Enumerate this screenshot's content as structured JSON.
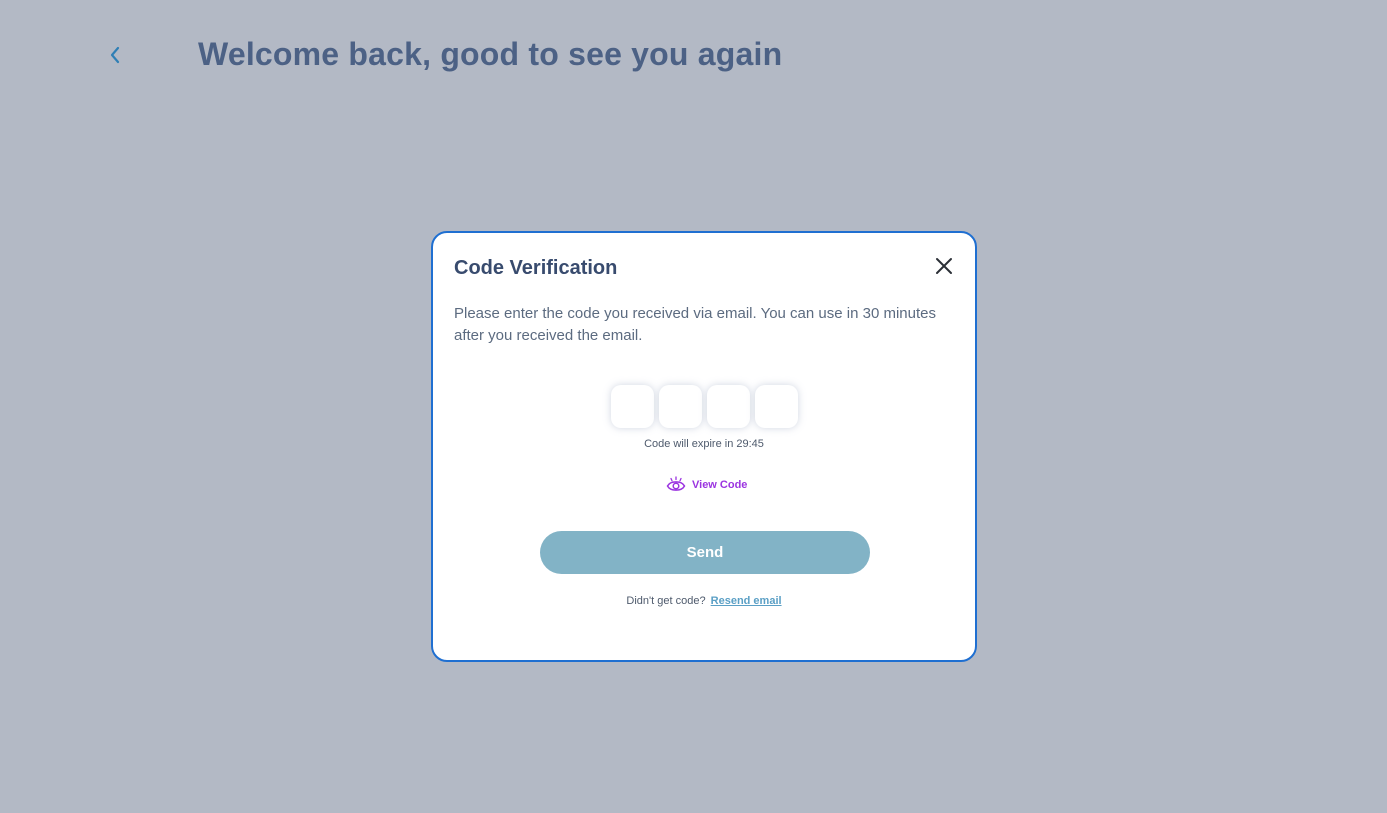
{
  "header": {
    "back_icon": "chevron-left-icon",
    "title": "Welcome back, good to see you again"
  },
  "modal": {
    "title": "Code Verification",
    "close_icon": "close-icon",
    "description": "Please enter the code you received via email. You can use in 30 minutes after you received the email.",
    "code_digits": [
      "",
      "",
      "",
      ""
    ],
    "expire_text": "Code will expire in 29:45",
    "view_code": {
      "icon": "eye-icon",
      "label": "View Code"
    },
    "send_label": "Send",
    "resend_prompt": "Didn't get code?",
    "resend_link": "Resend email"
  },
  "colors": {
    "background": "#b3b9c5",
    "title": "#4c6185",
    "modal_border": "#1f6fd1",
    "send_button": "#82b3c6",
    "view_code": "#9b34e0",
    "resend_link": "#5a9fc5"
  }
}
